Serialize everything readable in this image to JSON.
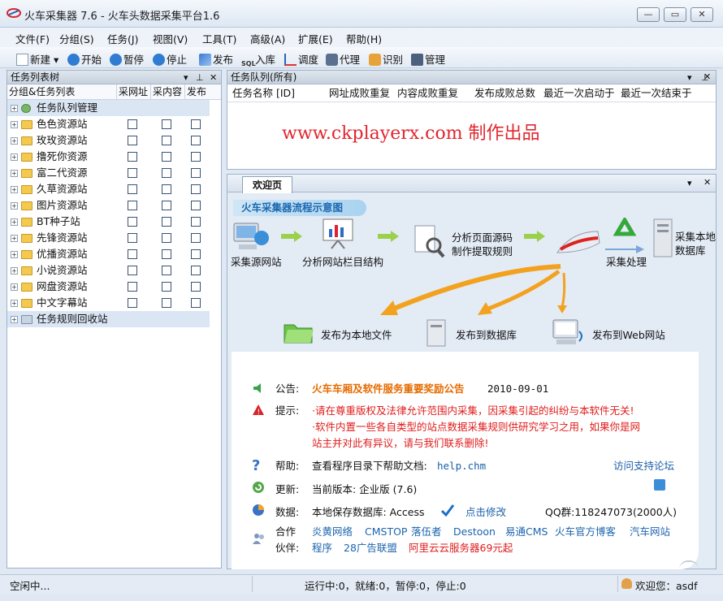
{
  "window": {
    "title": "火车采集器 7.6 - 火车头数据采集平台1.6"
  },
  "menu": [
    "文件(F)",
    "分组(S)",
    "任务(J)",
    "视图(V)",
    "工具(T)",
    "高级(A)",
    "扩展(E)",
    "帮助(H)"
  ],
  "toolbar": {
    "new": "新建",
    "start": "开始",
    "pause": "暂停",
    "stop": "停止",
    "publish": "发布",
    "import": "入库",
    "tune": "调度",
    "proxy": "代理",
    "recognize": "识别",
    "manage": "管理"
  },
  "task_tree": {
    "title": "任务列表树",
    "col_group": "分组&任务列表",
    "col_url": "采网址",
    "col_content": "采内容",
    "col_publish": "发布",
    "root": "任务队列管理",
    "items": [
      "色色资源站",
      "玫玫资源站",
      "撸死你资源",
      "富二代资源",
      "久草资源站",
      "图片资源站",
      "BT种子站",
      "先锋资源站",
      "优播资源站",
      "小说资源站",
      "网盘资源站",
      "中文字幕站"
    ],
    "recycle": "任务规则回收站"
  },
  "queue": {
    "title": "任务队列(所有)",
    "columns": [
      "任务名称 [ID]",
      "网址成败重复",
      "内容成败重复",
      "发布成败总数",
      "最近一次启动于",
      "最近一次结束于"
    ]
  },
  "watermark": "www.ckplayerx.com 制作出品",
  "welcome": {
    "tab": "欢迎页",
    "banner": "火车采集器流程示意图",
    "flow": {
      "source": "采集源网站",
      "analyze_structure": "分析网站栏目结构",
      "analyze_source_1": "分析页面源码",
      "analyze_source_2": "制作提取规则",
      "process": "采集处理",
      "db_1": "采集本地",
      "db_2": "数据库",
      "pub_local": "发布为本地文件",
      "pub_db": "发布到数据库",
      "pub_web": "发布到Web网站"
    },
    "notice": {
      "announce_label": "公告:",
      "announce_text": "火车车厢及软件服务重要奖励公告",
      "announce_date": "2010-09-01",
      "tip_label": "提示:",
      "tip_1": "·请在尊重版权及法律允许范围内采集，因采集引起的纠纷与本软件无关!",
      "tip_2a": "·软件内置一些各自类型的站点数据采集规则供研究学习之用，如果你是网",
      "tip_2b": "站主并对此有异议，请与我们联系删除!",
      "help_label": "帮助:",
      "help_text": "查看程序目录下帮助文档:",
      "help_file": "help.chm",
      "forum": "访问支持论坛",
      "update_label": "更新:",
      "update_text": "当前版本: 企业版  (7.6)",
      "data_label": "数据:",
      "data_text": "本地保存数据库: Access",
      "modify": "点击修改",
      "qq": "QQ群:118247073(2000人)",
      "partner_label_1": "合作",
      "partner_label_2": "伙伴:",
      "partners_row1": [
        "炎黄网络",
        "CMSTOP",
        "落伍者",
        "Destoon",
        "易通CMS",
        "火车官方博客",
        "汽车网站"
      ],
      "partners_row2": [
        "程序",
        "28广告联盟"
      ],
      "partner_promo": "阿里云云服务器69元起"
    }
  },
  "status": {
    "idle": "空闲中...",
    "counts": "运行中:0，就绪:0，暂停:0，停止:0",
    "user": "欢迎您：asdf"
  },
  "colors": {
    "accent_blue": "#1a5fa8",
    "warn_red": "#e01b1b",
    "notice_orange": "#e66b00"
  }
}
